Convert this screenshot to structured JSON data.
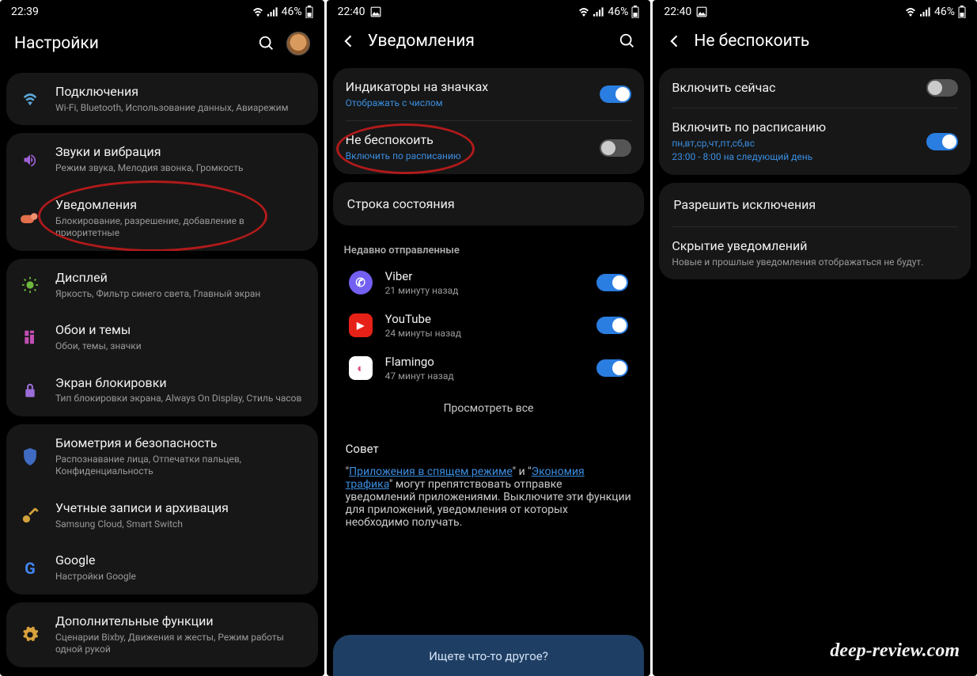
{
  "watermark": "deep-review.com",
  "screens": {
    "s1": {
      "status": {
        "time": "22:39",
        "battery": "46%"
      },
      "title": "Настройки",
      "items": [
        {
          "icon": "wifi",
          "color": "#4aa0d8",
          "title": "Подключения",
          "sub": "Wi-Fi, Bluetooth, Использование данных, Авиарежим"
        },
        {
          "icon": "sound",
          "color": "#a060d8",
          "title": "Звуки и вибрация",
          "sub": "Режим звука, Мелодия звонка, Громкость"
        },
        {
          "icon": "notify",
          "color": "#e2704c",
          "title": "Уведомления",
          "sub": "Блокирование, разрешение, добавление в приоритетные"
        },
        {
          "icon": "display",
          "color": "#6db83c",
          "title": "Дисплей",
          "sub": "Яркость, Фильтр синего света, Главный экран"
        },
        {
          "icon": "wallpaper",
          "color": "#c14fb3",
          "title": "Обои и темы",
          "sub": "Обои, темы, значки"
        },
        {
          "icon": "lock",
          "color": "#9a6dd8",
          "title": "Экран блокировки",
          "sub": "Тип блокировки экрана, Always On Display, Стиль часов"
        },
        {
          "icon": "biometric",
          "color": "#3f6cc2",
          "title": "Биометрия и безопасность",
          "sub": "Распознавание лица, Отпечатки пальцев, Конфиденциальность"
        },
        {
          "icon": "key",
          "color": "#d1a13a",
          "title": "Учетные записи и архивация",
          "sub": "Samsung Cloud, Smart Switch"
        },
        {
          "icon": "google",
          "color": "#4285f4",
          "title": "Google",
          "sub": "Настройки Google"
        },
        {
          "icon": "gear",
          "color": "#d9a23c",
          "title": "Дополнительные функции",
          "sub": "Сценарии Bixby, Движения и жесты, Режим работы одной рукой"
        }
      ]
    },
    "s2": {
      "status": {
        "time": "22:40",
        "battery": "46%"
      },
      "title": "Уведомления",
      "badge": {
        "title": "Индикаторы на значках",
        "sub": "Отображать с числом",
        "on": true
      },
      "dnd": {
        "title": "Не беспокоить",
        "sub": "Включить по расписанию",
        "on": false
      },
      "statusline": {
        "title": "Строка состояния"
      },
      "recent_label": "Недавно отправленные",
      "apps": [
        {
          "name": "Viber",
          "time": "21 минуту назад",
          "bg": "#7360f2",
          "glyph": "✆"
        },
        {
          "name": "YouTube",
          "time": "24 минуты назад",
          "bg": "#e62117",
          "glyph": "▶"
        },
        {
          "name": "Flamingo",
          "time": "47 минут назад",
          "bg": "#fff",
          "glyph": "◐"
        }
      ],
      "view_all": "Просмотреть все",
      "tip_title": "Совет",
      "tip_link1": "Приложения в спящем режиме",
      "tip_mid1": "\" и \"",
      "tip_link2": "Экономия трафика",
      "tip_rest": "\" могут препятствовать отправке уведомлений приложениями. Выключите эти функции для приложений, уведомления от которых необходимо получать.",
      "bottom_prompt": "Ищете что-то другое?"
    },
    "s3": {
      "status": {
        "time": "22:40",
        "battery": "46%"
      },
      "title": "Не беспокоить",
      "now": {
        "title": "Включить сейчас",
        "on": false
      },
      "sched": {
        "title": "Включить по расписанию",
        "days": "пн,вт,ср,чт,пт,сб,вс",
        "range": "23:00 - 8:00 на следующий день",
        "on": true
      },
      "exceptions": {
        "title": "Разрешить исключения"
      },
      "hide": {
        "title": "Скрытие уведомлений",
        "sub": "Новые и прошлые уведомления отображаться не будут."
      }
    }
  }
}
